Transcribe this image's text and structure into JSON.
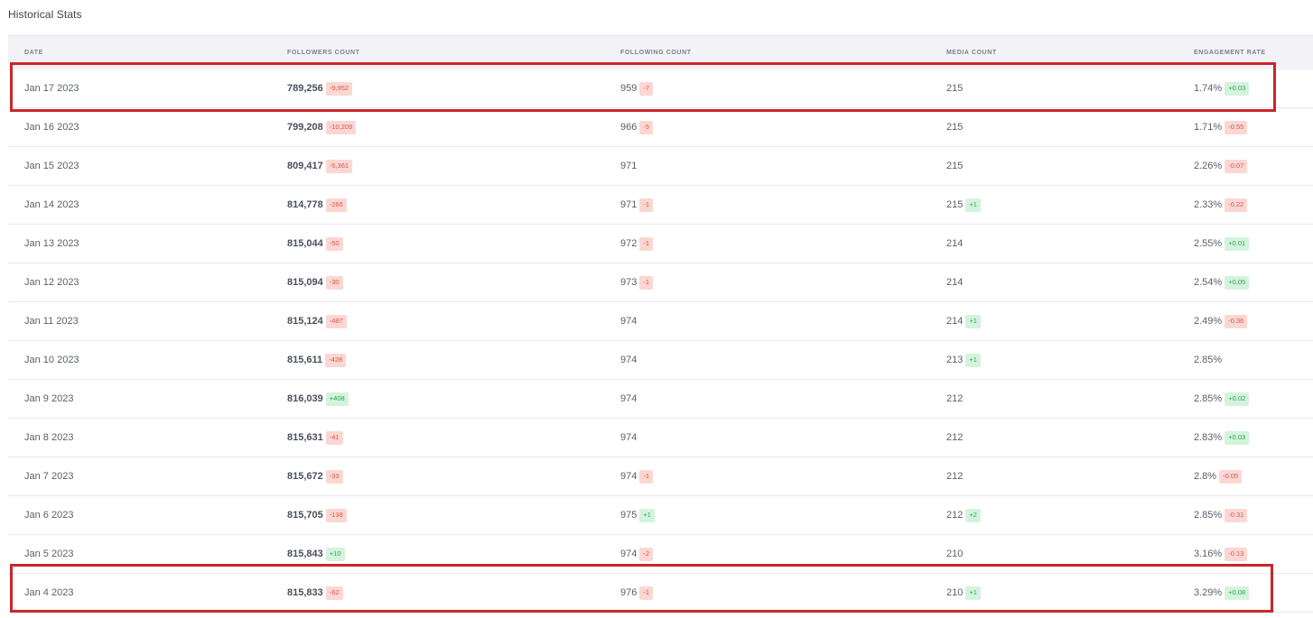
{
  "section": {
    "title": "Historical Stats"
  },
  "table": {
    "headers": {
      "date": "DATE",
      "followers": "FOLLOWERS COUNT",
      "following": "FOLLOWING COUNT",
      "media": "MEDIA COUNT",
      "engagement": "ENGAGEMENT RATE"
    },
    "rows": [
      {
        "date": "Jan 17 2023",
        "followers": "789,256",
        "followers_delta": "-9,952",
        "following": "959",
        "following_delta": "-7",
        "media": "215",
        "media_delta": "",
        "engagement": "1.74%",
        "engagement_delta": "+0.03",
        "highlighted": true
      },
      {
        "date": "Jan 16 2023",
        "followers": "799,208",
        "followers_delta": "-10,209",
        "following": "966",
        "following_delta": "-5",
        "media": "215",
        "media_delta": "",
        "engagement": "1.71%",
        "engagement_delta": "-0.55"
      },
      {
        "date": "Jan 15 2023",
        "followers": "809,417",
        "followers_delta": "-5,361",
        "following": "971",
        "following_delta": "",
        "media": "215",
        "media_delta": "",
        "engagement": "2.26%",
        "engagement_delta": "-0.07"
      },
      {
        "date": "Jan 14 2023",
        "followers": "814,778",
        "followers_delta": "-266",
        "following": "971",
        "following_delta": "-1",
        "media": "215",
        "media_delta": "+1",
        "engagement": "2.33%",
        "engagement_delta": "-0.22"
      },
      {
        "date": "Jan 13 2023",
        "followers": "815,044",
        "followers_delta": "-50",
        "following": "972",
        "following_delta": "-1",
        "media": "214",
        "media_delta": "",
        "engagement": "2.55%",
        "engagement_delta": "+0.01"
      },
      {
        "date": "Jan 12 2023",
        "followers": "815,094",
        "followers_delta": "-30",
        "following": "973",
        "following_delta": "-1",
        "media": "214",
        "media_delta": "",
        "engagement": "2.54%",
        "engagement_delta": "+0.05"
      },
      {
        "date": "Jan 11 2023",
        "followers": "815,124",
        "followers_delta": "-487",
        "following": "974",
        "following_delta": "",
        "media": "214",
        "media_delta": "+1",
        "engagement": "2.49%",
        "engagement_delta": "-0.36"
      },
      {
        "date": "Jan 10 2023",
        "followers": "815,611",
        "followers_delta": "-428",
        "following": "974",
        "following_delta": "",
        "media": "213",
        "media_delta": "+1",
        "engagement": "2.85%",
        "engagement_delta": ""
      },
      {
        "date": "Jan 9 2023",
        "followers": "816,039",
        "followers_delta": "+408",
        "following": "974",
        "following_delta": "",
        "media": "212",
        "media_delta": "",
        "engagement": "2.85%",
        "engagement_delta": "+0.02"
      },
      {
        "date": "Jan 8 2023",
        "followers": "815,631",
        "followers_delta": "-41",
        "following": "974",
        "following_delta": "",
        "media": "212",
        "media_delta": "",
        "engagement": "2.83%",
        "engagement_delta": "+0.03"
      },
      {
        "date": "Jan 7 2023",
        "followers": "815,672",
        "followers_delta": "-33",
        "following": "974",
        "following_delta": "-1",
        "media": "212",
        "media_delta": "",
        "engagement": "2.8%",
        "engagement_delta": "-0.05"
      },
      {
        "date": "Jan 6 2023",
        "followers": "815,705",
        "followers_delta": "-138",
        "following": "975",
        "following_delta": "+1",
        "media": "212",
        "media_delta": "+2",
        "engagement": "2.85%",
        "engagement_delta": "-0.31"
      },
      {
        "date": "Jan 5 2023",
        "followers": "815,843",
        "followers_delta": "+10",
        "following": "974",
        "following_delta": "-2",
        "media": "210",
        "media_delta": "",
        "engagement": "3.16%",
        "engagement_delta": "-0.13"
      },
      {
        "date": "Jan 4 2023",
        "followers": "815,833",
        "followers_delta": "-62",
        "following": "976",
        "following_delta": "-1",
        "media": "210",
        "media_delta": "+1",
        "engagement": "3.29%",
        "engagement_delta": "+0.08",
        "highlighted": true
      }
    ]
  },
  "colors": {
    "negative_badge_bg": "#fbd7d3",
    "negative_badge_text": "#d9544a",
    "positive_badge_bg": "#d4f3dc",
    "positive_badge_text": "#2fa556",
    "highlight_border": "#c9262c"
  }
}
